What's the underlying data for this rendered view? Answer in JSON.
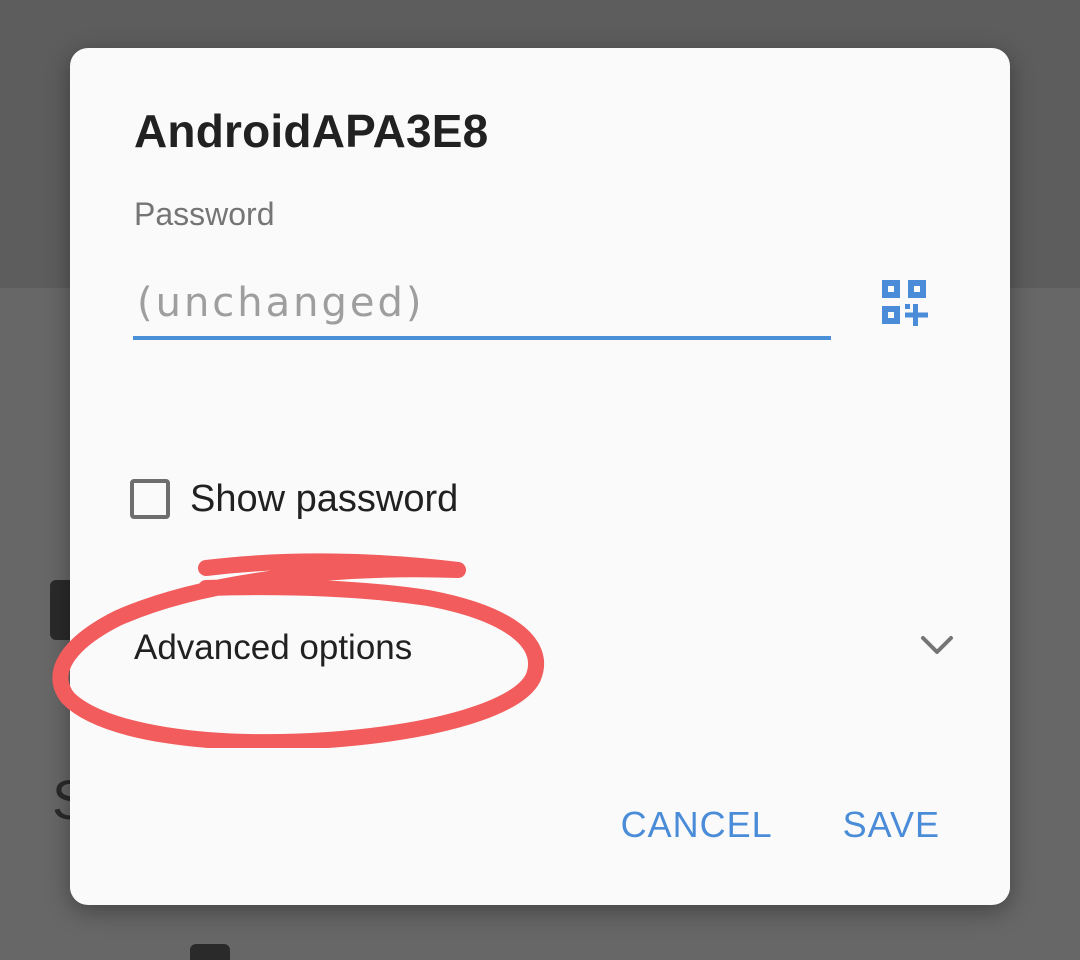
{
  "dialog": {
    "title": "AndroidAPA3E8",
    "password_label": "Password",
    "password_placeholder": "(unchanged)",
    "password_value": "",
    "qr_icon": "qr-code-scanner-icon",
    "show_password_label": "Show password",
    "show_password_checked": false,
    "advanced_options_label": "Advanced options",
    "expand_icon": "chevron-down-icon",
    "cancel_label": "CANCEL",
    "save_label": "SAVE"
  },
  "colors": {
    "accent": "#4a8cd8",
    "annotation": "#f25c5c",
    "scrim": "#676767"
  }
}
